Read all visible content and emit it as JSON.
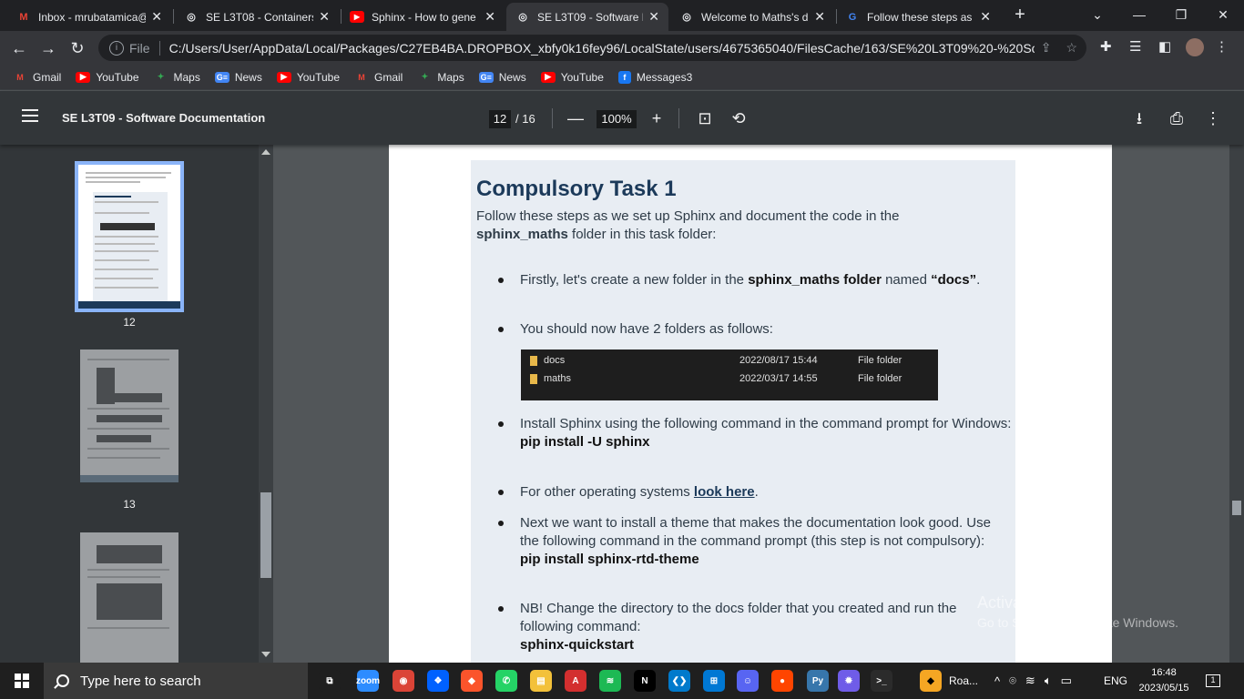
{
  "browser": {
    "tabs": [
      {
        "title": "Inbox - mrubatamica@",
        "icon": "gmail-icon",
        "color": "#ea4335",
        "glyph": "M"
      },
      {
        "title": "SE L3T08 - Containers",
        "icon": "chrome-icon",
        "color": "#e8eaed",
        "glyph": "◎"
      },
      {
        "title": "Sphinx - How to gene",
        "icon": "youtube-icon",
        "color": "#ff0000",
        "glyph": "▶"
      },
      {
        "title": "SE L3T09 - Software D",
        "icon": "chrome-icon",
        "color": "#e8eaed",
        "glyph": "◎"
      },
      {
        "title": "Welcome to Maths's d",
        "icon": "chrome-icon",
        "color": "#e8eaed",
        "glyph": "◎"
      },
      {
        "title": "Follow these steps as",
        "icon": "google-icon",
        "color": "#4285f4",
        "glyph": "G"
      }
    ],
    "new_tab": "+",
    "url_scheme": "File",
    "url": "C:/Users/User/AppData/Local/Packages/C27EB4BA.DROPBOX_xbfy0k16fey96/LocalState/users/4675365040/FilesCache/163/SE%20L3T09%20-%20Softw...",
    "bookmarks": [
      {
        "label": "Gmail",
        "icon": "gmail-icon",
        "color": "#ea4335",
        "glyph": "M"
      },
      {
        "label": "YouTube",
        "icon": "youtube-icon",
        "color": "#ff0000",
        "glyph": "▶"
      },
      {
        "label": "Maps",
        "icon": "maps-icon",
        "color": "#34a853",
        "glyph": "✦"
      },
      {
        "label": "News",
        "icon": "news-icon",
        "color": "#4285f4",
        "glyph": "G≡"
      },
      {
        "label": "YouTube",
        "icon": "youtube-icon",
        "color": "#ff0000",
        "glyph": "▶"
      },
      {
        "label": "Gmail",
        "icon": "gmail-icon",
        "color": "#ea4335",
        "glyph": "M"
      },
      {
        "label": "Maps",
        "icon": "maps-icon",
        "color": "#34a853",
        "glyph": "✦"
      },
      {
        "label": "News",
        "icon": "news-icon",
        "color": "#4285f4",
        "glyph": "G≡"
      },
      {
        "label": "YouTube",
        "icon": "youtube-icon",
        "color": "#ff0000",
        "glyph": "▶"
      },
      {
        "label": "Messages3",
        "icon": "facebook-icon",
        "color": "#1877f2",
        "glyph": "f"
      }
    ]
  },
  "pdf": {
    "title": "SE L3T09 - Software Documentation",
    "current_page": "12",
    "total_pages": "/ 16",
    "zoom": "100%",
    "thumbnails": [
      "12",
      "13"
    ]
  },
  "content": {
    "heading": "Compulsory Task 1",
    "intro_a": "Follow these steps as we set up Sphinx and document the code in the ",
    "intro_b": "sphinx_maths",
    "intro_c": " folder in this task folder:",
    "b1_a": "Firstly, let's create a new folder in the ",
    "b1_b": "sphinx_maths folder",
    "b1_c": " named ",
    "b1_d": "“docs”",
    "b1_e": ".",
    "b2": "You should now have 2 folders as follows:",
    "folders": [
      {
        "name": "docs",
        "date": "2022/08/17 15:44",
        "type": "File folder"
      },
      {
        "name": "maths",
        "date": "2022/03/17 14:55",
        "type": "File folder"
      }
    ],
    "b3": "Install Sphinx using the following command in the command prompt for Windows:",
    "b3_cmd": "pip install -U sphinx",
    "b4_a": "For other operating systems ",
    "b4_link": "look here",
    "b4_b": ".",
    "b5": "Next we want to install a theme that makes the documentation look good. Use the following command in the command prompt (this step is not compulsory):",
    "b5_cmd": "pip install sphinx-rtd-theme",
    "b6": "NB! Change the directory to the docs folder that you created and run the following command:",
    "b6_cmd": "sphinx-quickstart"
  },
  "watermark": {
    "line1": "Activate Windows",
    "line2": "Go to Settings to activate Windows."
  },
  "taskbar": {
    "search_placeholder": "Type here to search",
    "apps": [
      {
        "name": "task-view-icon",
        "color": "#1f1f1f",
        "glyph": "⧉"
      },
      {
        "name": "zoom-icon",
        "color": "#2d8cff",
        "glyph": "zoom"
      },
      {
        "name": "chrome-icon",
        "color": "#db4437",
        "glyph": "◉"
      },
      {
        "name": "dropbox-icon",
        "color": "#0061ff",
        "glyph": "❖"
      },
      {
        "name": "brave-icon",
        "color": "#fb542b",
        "glyph": "◆"
      },
      {
        "name": "whatsapp-icon",
        "color": "#25d366",
        "glyph": "✆"
      },
      {
        "name": "file-explorer-icon",
        "color": "#f3c13a",
        "glyph": "▤"
      },
      {
        "name": "acrobat-icon",
        "color": "#d32f2f",
        "glyph": "A"
      },
      {
        "name": "spotify-icon",
        "color": "#1db954",
        "glyph": "≋"
      },
      {
        "name": "netflix-icon",
        "color": "#000000",
        "glyph": "N"
      },
      {
        "name": "vscode-icon",
        "color": "#007acc",
        "glyph": "❮❯"
      },
      {
        "name": "store-icon",
        "color": "#0078d4",
        "glyph": "⊞"
      },
      {
        "name": "discord-icon",
        "color": "#5865f2",
        "glyph": "☺"
      },
      {
        "name": "reddit-icon",
        "color": "#ff4500",
        "glyph": "●"
      },
      {
        "name": "python-icon",
        "color": "#3776ab",
        "glyph": "Py"
      },
      {
        "name": "settings-icon",
        "color": "#6f5ce8",
        "glyph": "✹"
      },
      {
        "name": "terminal-icon",
        "color": "#2b2b2b",
        "glyph": ">_"
      }
    ],
    "roblox_label": "Roa...",
    "language": "ENG",
    "time": "16:48",
    "date": "2023/05/15",
    "notifications": "1"
  }
}
